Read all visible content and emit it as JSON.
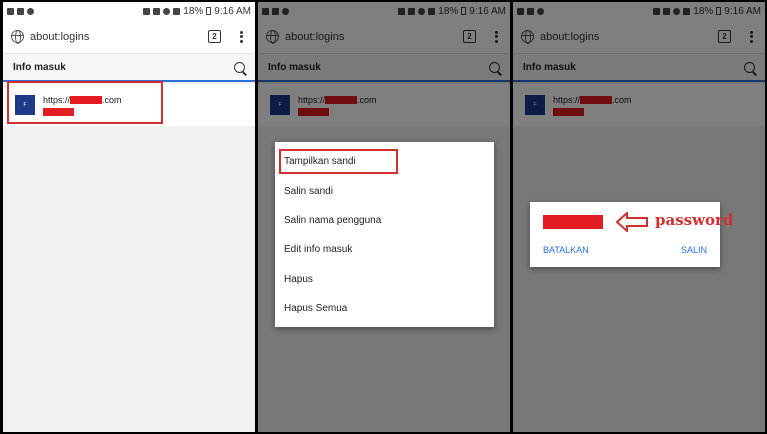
{
  "status": {
    "battery": "18%",
    "time": "9:16 AM"
  },
  "toolbar": {
    "url": "about:logins",
    "tab_count": "2"
  },
  "header": {
    "title": "Info masuk"
  },
  "login": {
    "url_prefix": "https://",
    "url_suffix": ".com",
    "favicon_letter": "F"
  },
  "menu": {
    "items": [
      "Tampilkan sandi",
      "Salin sandi",
      "Salin nama pengguna",
      "Edit info masuk",
      "Hapus",
      "Hapus Semua"
    ]
  },
  "dialog": {
    "annotation": "password",
    "cancel_label": "BATALKAN",
    "copy_label": "SALIN"
  },
  "colors": {
    "accent": "#2b6fd8",
    "redaction": "#e31b23",
    "annotation": "#d32f2f",
    "favicon": "#1d3b86"
  }
}
